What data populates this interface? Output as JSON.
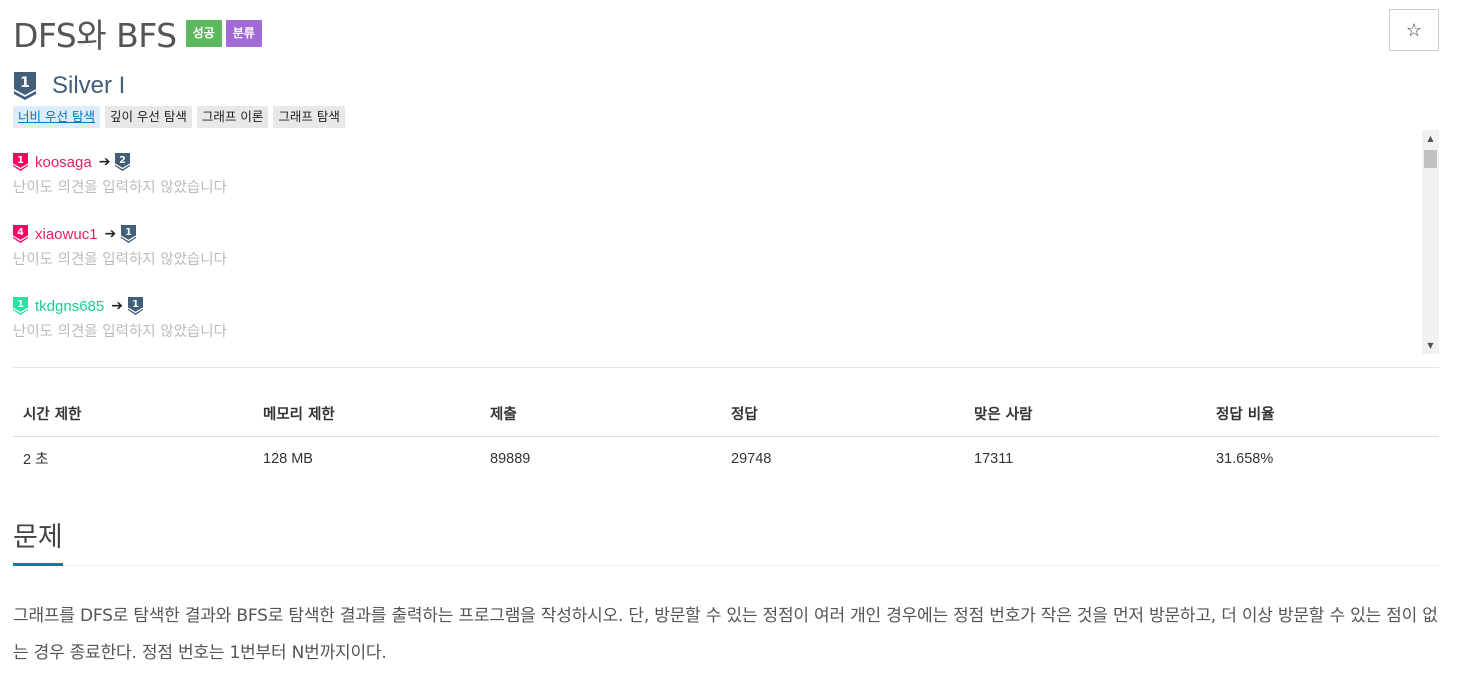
{
  "problem": {
    "title": "DFS와 BFS",
    "labels": {
      "success": "성공",
      "category": "분류"
    },
    "star_icon": "☆"
  },
  "tier": {
    "number": "1",
    "name": "Silver I",
    "color": "#435f7a"
  },
  "tags": [
    "너비 우선 탐색",
    "깊이 우선 탐색",
    "그래프 이론",
    "그래프 탐색"
  ],
  "opinions": [
    {
      "from_tier": "1",
      "from_color": "#ff0062",
      "user": "koosaga",
      "user_color": "#e0245e",
      "arrow": "➔",
      "to_tier": "2",
      "to_color": "#435f7a",
      "text": "난이도 의견을 입력하지 않았습니다"
    },
    {
      "from_tier": "4",
      "from_color": "#ff0062",
      "user": "xiaowuc1",
      "user_color": "#e0245e",
      "arrow": "➔",
      "to_tier": "1",
      "to_color": "#435f7a",
      "text": "난이도 의견을 입력하지 않았습니다"
    },
    {
      "from_tier": "1",
      "from_color": "#27e2a4",
      "user": "tkdgns685",
      "user_color": "#20c997",
      "arrow": "➔",
      "to_tier": "1",
      "to_color": "#435f7a",
      "text": "난이도 의견을 입력하지 않았습니다"
    }
  ],
  "info": {
    "headers": [
      "시간 제한",
      "메모리 제한",
      "제출",
      "정답",
      "맞은 사람",
      "정답 비율"
    ],
    "values": [
      "2 초",
      "128 MB",
      "89889",
      "29748",
      "17311",
      "31.658%"
    ]
  },
  "section": {
    "title": "문제",
    "description": "그래프를 DFS로 탐색한 결과와 BFS로 탐색한 결과를 출력하는 프로그램을 작성하시오. 단, 방문할 수 있는 정점이 여러 개인 경우에는 정점 번호가 작은 것을 먼저 방문하고, 더 이상 방문할 수 있는 점이 없는 경우 종료한다. 정점 번호는 1번부터 N번까지이다."
  }
}
